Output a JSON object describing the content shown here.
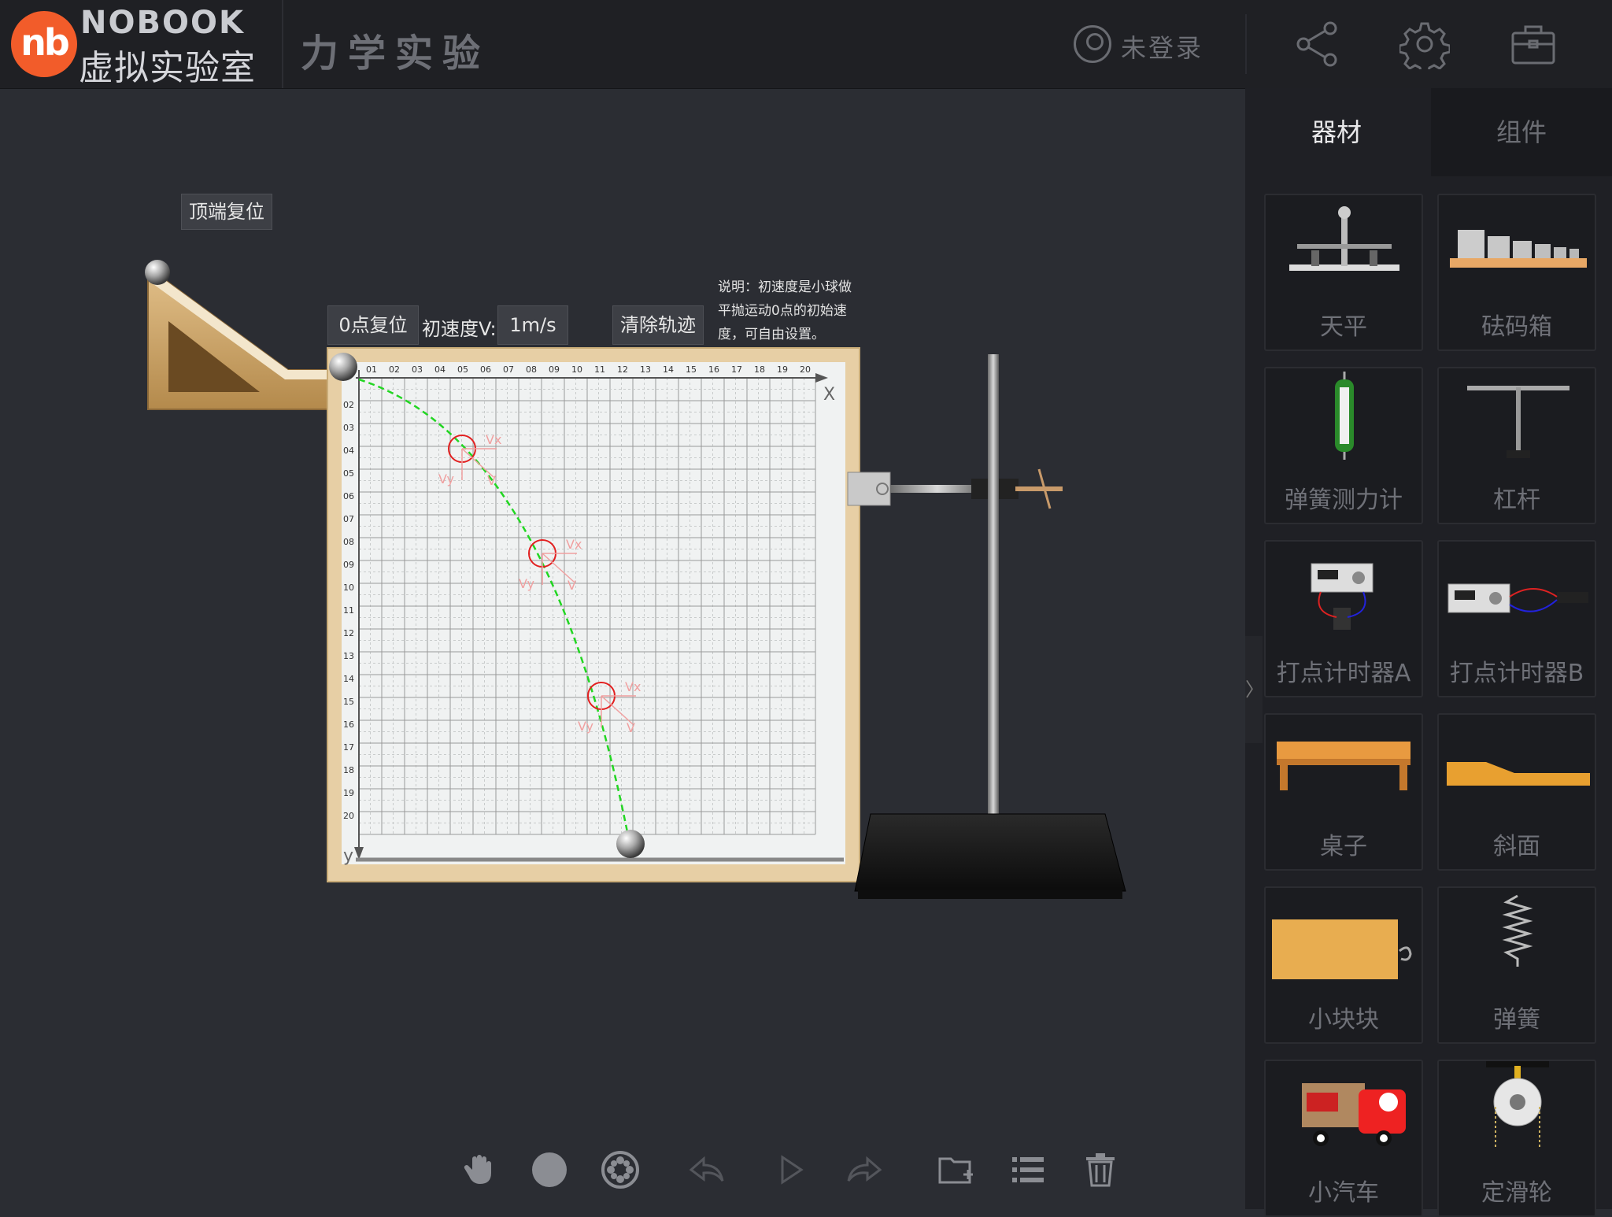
{
  "header": {
    "logo_icon": "nb",
    "logo_brand": "NOBOOK",
    "logo_sub": "虚拟实验室",
    "title": "力学实验",
    "user_label": "未登录",
    "icons": [
      "share-icon",
      "gear-icon",
      "toolbox-icon"
    ]
  },
  "experiment": {
    "top_reset_label": "顶端复位",
    "zero_reset_label": "0点复位",
    "velocity_label": "初速度V:",
    "velocity_value": "1m/s",
    "clear_label": "清除轨迹",
    "note": [
      "说明：初速度是小球做",
      "平抛运动0点的初始速",
      "度，可自由设置。"
    ],
    "x_axis_label": "X",
    "y_axis_label": "y",
    "x_ticks": [
      "01",
      "02",
      "03",
      "04",
      "05",
      "06",
      "07",
      "08",
      "09",
      "10",
      "11",
      "12",
      "13",
      "14",
      "15",
      "16",
      "17",
      "18",
      "19",
      "20"
    ],
    "y_ticks": [
      "02",
      "03",
      "04",
      "05",
      "06",
      "07",
      "08",
      "09",
      "10",
      "11",
      "12",
      "13",
      "14",
      "15",
      "16",
      "17",
      "18",
      "19",
      "20"
    ],
    "vector_labels": {
      "vx": "Vx",
      "vy": "Vy",
      "v": "V"
    }
  },
  "panel": {
    "tabs": [
      "器材",
      "组件"
    ],
    "active_tab": "器材",
    "items": [
      "天平",
      "砝码箱",
      "弹簧测力计",
      "杠杆",
      "打点计时器A",
      "打点计时器B",
      "桌子",
      "斜面",
      "小块块",
      "弹簧",
      "小汽车",
      "定滑轮"
    ]
  },
  "toolbar": {
    "icons": [
      "hand-icon",
      "circle-icon",
      "film-reel-icon",
      "undo-icon",
      "play-icon",
      "redo-icon",
      "folder-add-icon",
      "list-icon",
      "trash-icon"
    ]
  },
  "colors": {
    "background": "#2b2d33",
    "header": "#1f2024",
    "panel": "#1f2025",
    "logo": "#f25c2a",
    "trajectory": "#22d622",
    "markers": "#e22020"
  }
}
